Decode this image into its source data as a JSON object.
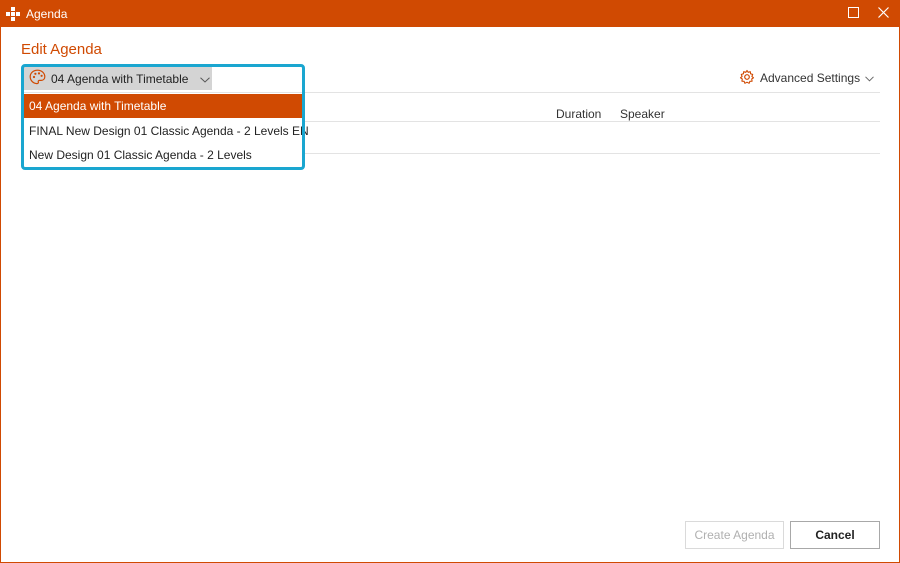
{
  "window": {
    "title": "Agenda",
    "accent_color": "#d04a02",
    "highlight_color": "#1aa6d0",
    "controls": [
      "maximize-icon",
      "close-icon"
    ]
  },
  "main": {
    "heading": "Edit Agenda",
    "template_selector": {
      "icon": "palette-icon",
      "selected": "04 Agenda with Timetable"
    },
    "template_options": [
      "04 Agenda with Timetable",
      "FINAL New Design 01 Classic Agenda - 2 Levels EN",
      "New Design 01 Classic Agenda - 2 Levels"
    ],
    "advanced_settings": {
      "icon": "gear-icon",
      "label": "Advanced Settings"
    },
    "columns": {
      "duration": "Duration",
      "speaker": "Speaker"
    }
  },
  "footer": {
    "create_label": "Create Agenda",
    "cancel_label": "Cancel"
  }
}
